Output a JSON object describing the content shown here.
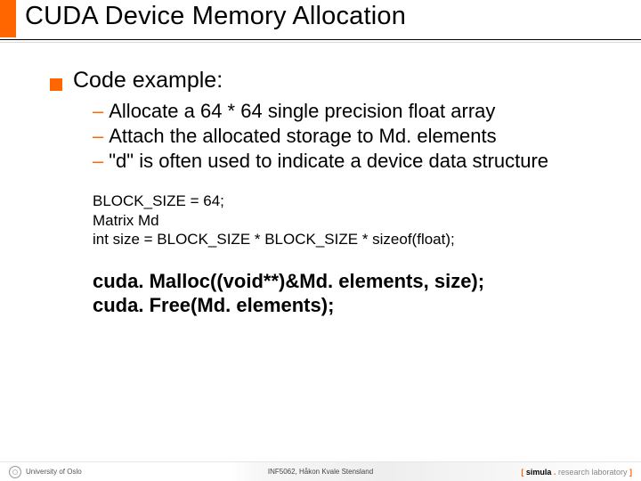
{
  "title": "CUDA Device Memory Allocation",
  "bullet": {
    "heading": "Code example:",
    "items": [
      "Allocate a  64 * 64 single precision float array",
      "Attach the allocated storage to Md. elements",
      "\"d\" is often used to indicate a device data structure"
    ]
  },
  "code": {
    "line1": "BLOCK_SIZE = 64;",
    "line2": "Matrix Md",
    "line3": "int size = BLOCK_SIZE * BLOCK_SIZE * sizeof(float);"
  },
  "calls": {
    "line1": "cuda. Malloc((void**)&Md. elements, size);",
    "line2": "cuda. Free(Md. elements);"
  },
  "footer": {
    "left": "University of Oslo",
    "center": "INF5062, Håkon Kvale Stensland",
    "right_simula": "simula",
    "right_rest": "research laboratory"
  }
}
